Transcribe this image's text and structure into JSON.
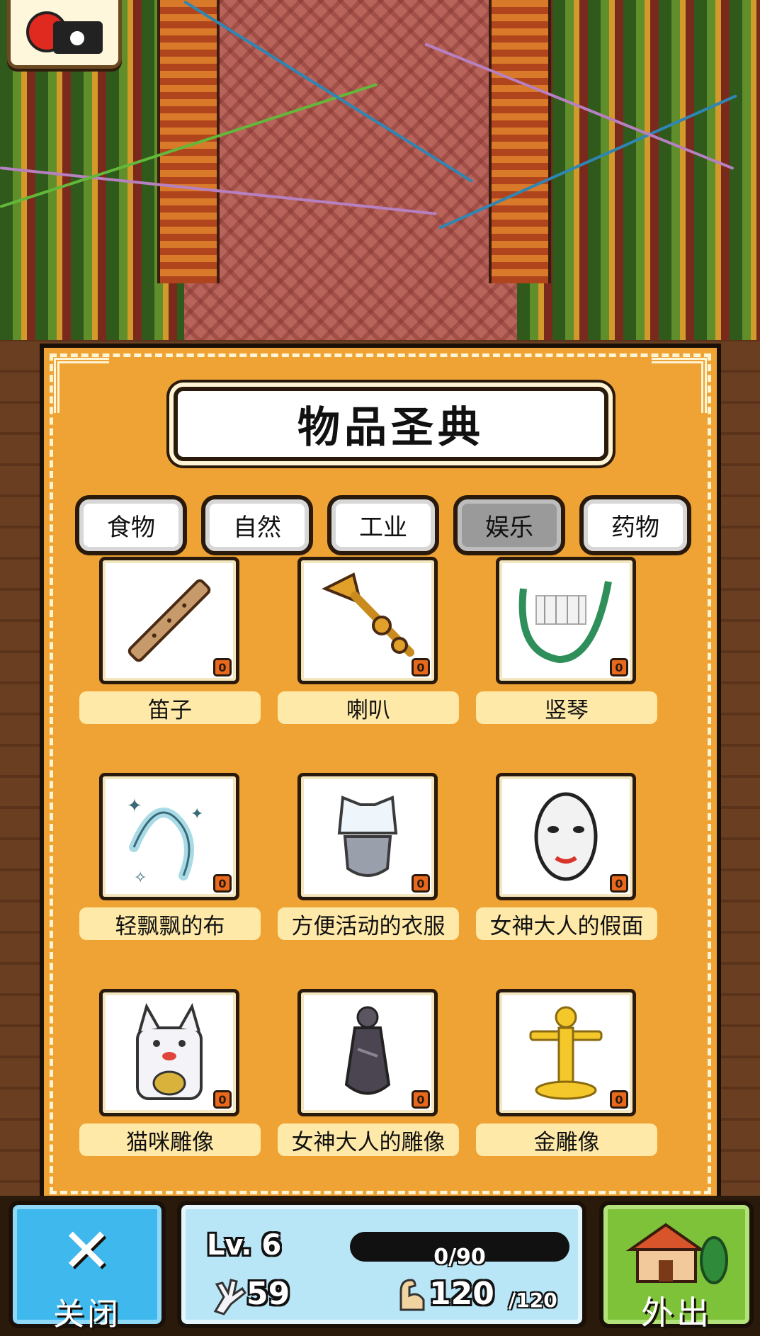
{
  "panel": {
    "title": "物品圣典",
    "tabs": [
      {
        "label": "食物",
        "active": false
      },
      {
        "label": "自然",
        "active": false
      },
      {
        "label": "工业",
        "active": false
      },
      {
        "label": "娱乐",
        "active": true
      },
      {
        "label": "药物",
        "active": false
      }
    ],
    "items": [
      {
        "name": "笛子",
        "count": "0",
        "icon": "flute-icon"
      },
      {
        "name": "喇叭",
        "count": "0",
        "icon": "trumpet-icon"
      },
      {
        "name": "竖琴",
        "count": "0",
        "icon": "harp-icon"
      },
      {
        "name": "轻飘飘的布",
        "count": "0",
        "icon": "fluttering-cloth-icon"
      },
      {
        "name": "方便活动的衣服",
        "count": "0",
        "icon": "clothes-icon"
      },
      {
        "name": "女神大人的假面",
        "count": "0",
        "icon": "goddess-mask-icon"
      },
      {
        "name": "猫咪雕像",
        "count": "0",
        "icon": "lucky-cat-statue-icon"
      },
      {
        "name": "女神大人的雕像",
        "count": "0",
        "icon": "goddess-statue-icon"
      },
      {
        "name": "金雕像",
        "count": "0",
        "icon": "gold-statue-icon"
      }
    ]
  },
  "close_button": {
    "label": "关闭",
    "icon": "close-x-icon"
  },
  "status": {
    "level": "Lv. 6",
    "xp_text": "0/90",
    "xp_fraction": 0,
    "stamina": "59",
    "power": "120",
    "power_max": "/120"
  },
  "out_button": {
    "label": "外出",
    "icon": "house-icon"
  },
  "camera_button": {
    "icon": "camera-icon"
  },
  "colors": {
    "panel": "#efa334",
    "label_bg": "#ffe9a8",
    "close": "#3fb8ee",
    "out": "#7ec23a",
    "status": "#b9e6f6"
  }
}
